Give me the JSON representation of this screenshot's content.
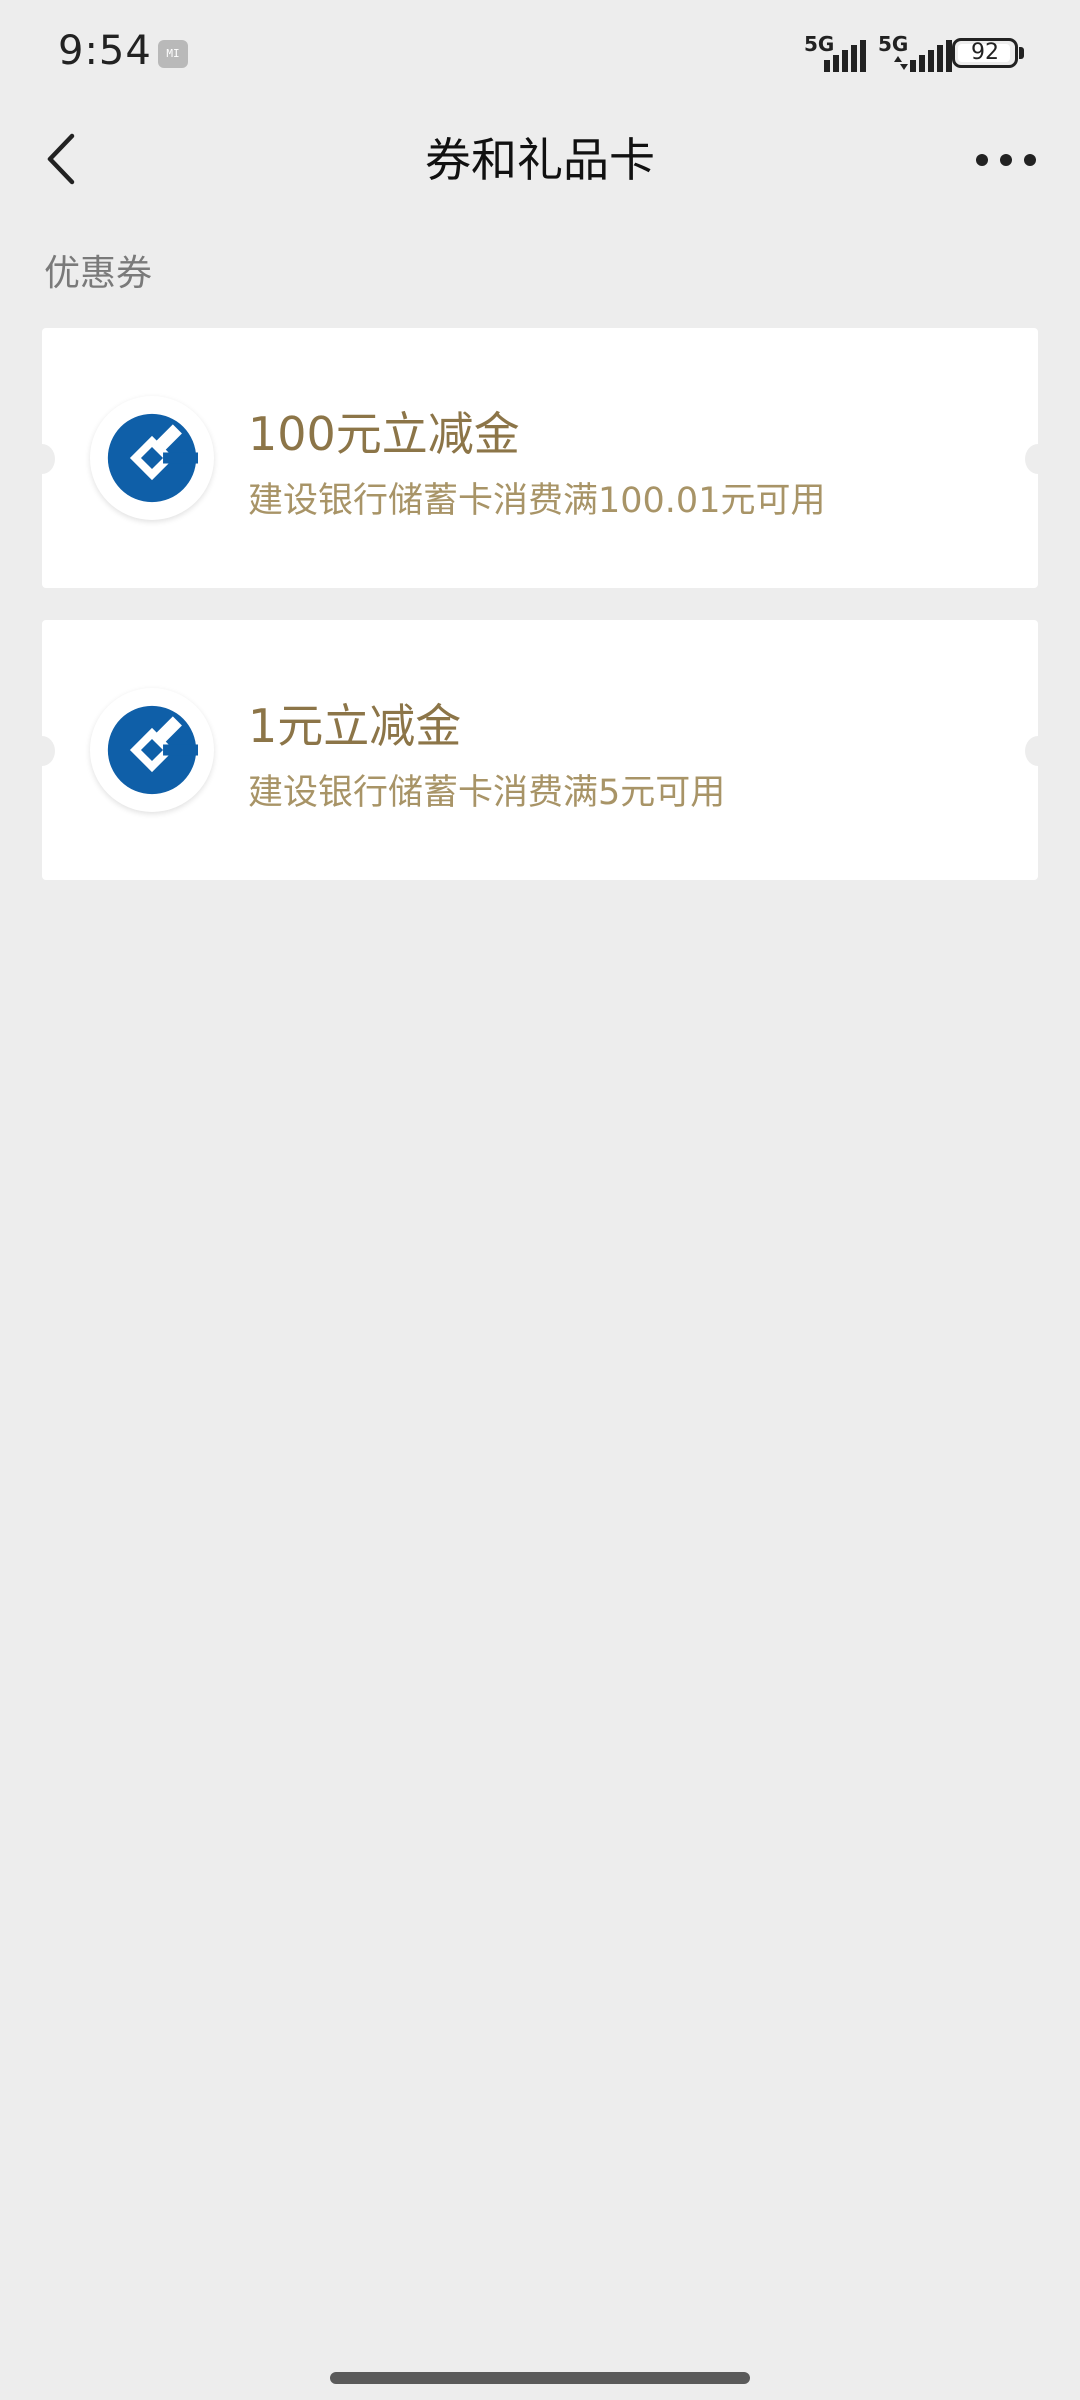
{
  "status_bar": {
    "time": "9:54",
    "mi_badge": "MI",
    "sim1_label": "5G",
    "sim2_label": "5G",
    "battery_level": "92",
    "icons": [
      "mi-notification-icon",
      "signal-icon",
      "signal-icon",
      "battery-icon"
    ]
  },
  "nav": {
    "title": "券和礼品卡",
    "back_icon": "chevron-left-icon",
    "more_icon": "more-dots-icon"
  },
  "section": {
    "label": "优惠券"
  },
  "coupons": [
    {
      "title": "100元立减金",
      "description": "建设银行储蓄卡消费满100.01元可用",
      "logo_icon": "ccb-bank-logo-icon"
    },
    {
      "title": "1元立减金",
      "description": "建设银行储蓄卡消费满5元可用",
      "logo_icon": "ccb-bank-logo-icon"
    }
  ],
  "colors": {
    "background": "#ededed",
    "card": "#ffffff",
    "coupon_title": "#8c7548",
    "coupon_desc": "#a89467",
    "ccb_blue": "#0f5fa8"
  }
}
